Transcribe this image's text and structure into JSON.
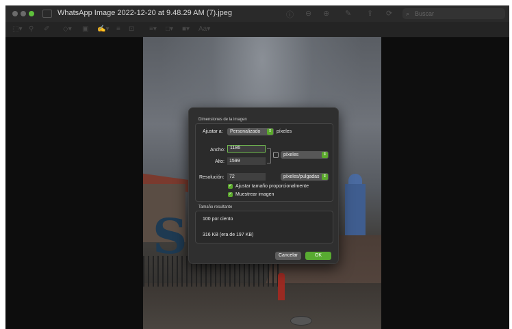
{
  "window": {
    "title": "WhatsApp Image 2022-12-20 at 9.48.29 AM (7).jpeg",
    "search_placeholder": "Buscar"
  },
  "dialog": {
    "section_dimensions": "Dimensiones de la imagen",
    "fit_label": "Ajustar a:",
    "fit_value": "Personalizado",
    "fit_unit": "píxeles",
    "width_label": "Ancho:",
    "width_value": "1186",
    "height_label": "Alto:",
    "height_value": "1599",
    "size_unit": "píxeles",
    "resolution_label": "Resolución:",
    "resolution_value": "72",
    "resolution_unit": "píxeles/pulgadas",
    "scale_proportionally": "Ajustar tamaño proporcionalmente",
    "resample": "Muestrear imagen",
    "section_result": "Tamaño resultante",
    "result_percent": "100 por ciento",
    "result_size": "316 KB (era de 197 KB)",
    "cancel_label": "Cancelar",
    "ok_label": "OK"
  },
  "colors": {
    "accent": "#5ba82c",
    "dialog_bg": "#2f2f2f",
    "window_bg": "#0d0d0d"
  }
}
